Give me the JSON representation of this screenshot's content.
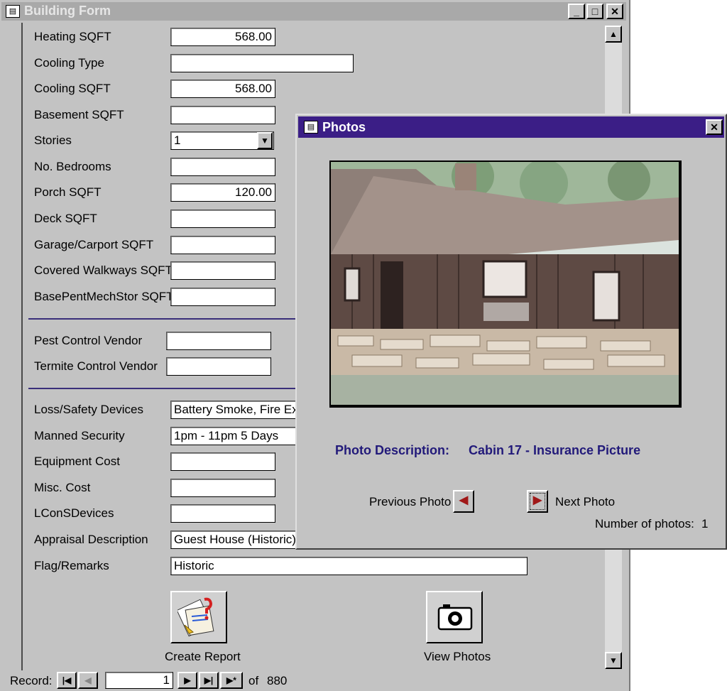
{
  "main_window": {
    "title": "Building Form",
    "fields": [
      {
        "label": "Heating SQFT",
        "value": "568.00"
      },
      {
        "label": "Cooling Type",
        "value": ""
      },
      {
        "label": "Cooling SQFT",
        "value": "568.00"
      },
      {
        "label": "Basement SQFT",
        "value": ""
      },
      {
        "label": "Stories",
        "value": "1"
      },
      {
        "label": "No. Bedrooms",
        "value": ""
      },
      {
        "label": "Porch SQFT",
        "value": "120.00"
      },
      {
        "label": "Deck SQFT",
        "value": ""
      },
      {
        "label": "Garage/Carport SQFT",
        "value": ""
      },
      {
        "label": "Covered Walkways SQFT",
        "value": ""
      },
      {
        "label": "BasePentMechStor SQFT",
        "value": ""
      }
    ],
    "vendors": [
      {
        "label": "Pest  Control Vendor",
        "value": ""
      },
      {
        "label": "Termite Control Vendor",
        "value": ""
      }
    ],
    "extra": [
      {
        "label": "Loss/Safety Devices",
        "value": "Battery Smoke, Fire Exti"
      },
      {
        "label": "Manned Security",
        "value": "1pm - 11pm 5 Days"
      },
      {
        "label": "Equipment Cost",
        "value": ""
      },
      {
        "label": "Misc. Cost",
        "value": ""
      },
      {
        "label": "LConSDevices",
        "value": ""
      },
      {
        "label": "Appraisal Description",
        "value": "Guest House (Historic),"
      },
      {
        "label": "Flag/Remarks",
        "value": "Historic"
      }
    ],
    "buttons": {
      "create_report": "Create Report",
      "view_photos": "View Photos"
    },
    "record_nav": {
      "label": "Record:",
      "current": "1",
      "of_label": "of",
      "total": "880"
    }
  },
  "photos_window": {
    "title": "Photos",
    "description_label": "Photo Description:",
    "description_value": "Cabin 17 - Insurance Picture",
    "previous_label": "Previous Photo",
    "next_label": "Next Photo",
    "count_label": "Number of photos:",
    "count_value": "1"
  },
  "colors": {
    "form_bg": "#c3c3c3",
    "photos_title_bar": "#3b1e86",
    "description_text": "#221a7a"
  },
  "icons": [
    "form-icon",
    "minimize-icon",
    "maximize-icon",
    "close-icon",
    "report-icon",
    "camera-icon",
    "first-record-icon",
    "prev-record-icon",
    "next-record-icon",
    "last-record-icon",
    "new-record-icon"
  ]
}
